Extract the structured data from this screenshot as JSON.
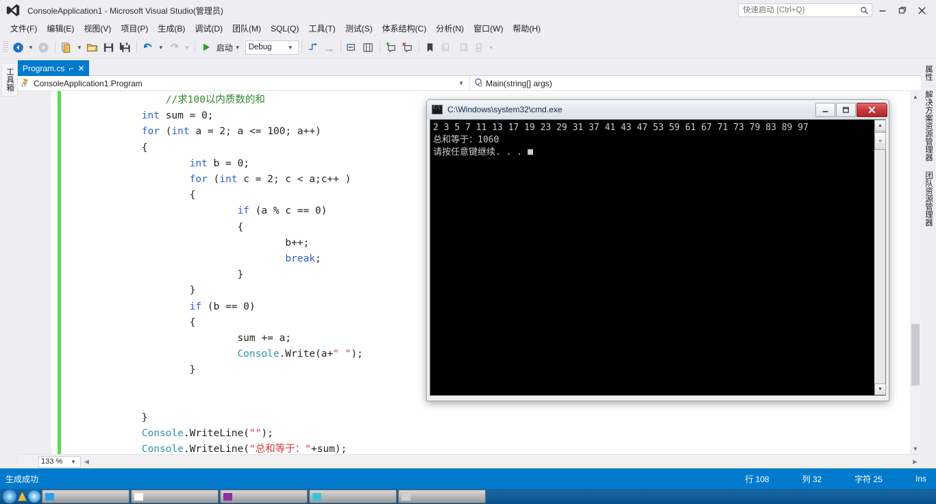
{
  "window": {
    "title": "ConsoleApplication1 - Microsoft Visual Studio(管理员)",
    "logo_icon": "visual-studio-logo",
    "minimize_icon": "—",
    "maximize_icon": "❐",
    "close_icon": "✕"
  },
  "quick_launch": {
    "placeholder": "快速启动 (Ctrl+Q)",
    "value": "",
    "icon": "search-icon"
  },
  "menubar": {
    "items": [
      {
        "label": "文件(F)"
      },
      {
        "label": "编辑(E)"
      },
      {
        "label": "视图(V)"
      },
      {
        "label": "项目(P)"
      },
      {
        "label": "生成(B)"
      },
      {
        "label": "调试(D)"
      },
      {
        "label": "团队(M)"
      },
      {
        "label": "SQL(Q)"
      },
      {
        "label": "工具(T)"
      },
      {
        "label": "测试(S)"
      },
      {
        "label": "体系结构(C)"
      },
      {
        "label": "分析(N)"
      },
      {
        "label": "窗口(W)"
      },
      {
        "label": "帮助(H)"
      }
    ]
  },
  "toolbar": {
    "navigate_back": "navigate-back-icon",
    "navigate_forward": "navigate-forward-icon",
    "new_project": "new-project-icon",
    "open_file": "open-file-icon",
    "save": "save-icon",
    "save_all": "save-all-icon",
    "undo": "undo-icon",
    "redo": "redo-icon",
    "start_label": "启动",
    "start_icon": "play-icon",
    "configuration": "Debug",
    "step_into": "step-into-icon",
    "step_over": "step-over-icon",
    "comment": "comment-icon",
    "uncomment": "uncomment-icon",
    "add_bookmark": "add-bookmark-icon",
    "remove_bookmark": "remove-bookmark-icon",
    "toggle_bookmark": "toggle-bookmark-icon",
    "prev_bookmark": "previous-bookmark-icon",
    "next_bookmark": "next-bookmark-icon",
    "clear_bookmarks": "clear-bookmarks-icon",
    "overflow": "toolbar-overflow-icon"
  },
  "left_dock": {
    "tabs": [
      {
        "label": "工具箱"
      }
    ]
  },
  "right_dock": {
    "tabs": [
      {
        "label": "属性"
      },
      {
        "label": "解决方案资源管理器"
      },
      {
        "label": "团队资源管理器"
      }
    ]
  },
  "editor": {
    "tab": {
      "label": "Program.cs",
      "pin_icon": "pin-icon",
      "close_icon": "close-icon"
    },
    "navbar": {
      "type_icon": "class-icon",
      "type": "ConsoleApplication1.Program",
      "member_icon": "method-icon",
      "member": "Main(string[] args)",
      "dropdown_icon": "chevron-down-icon"
    },
    "zoom_level": "133 %",
    "zoom_dropdown_icon": "chevron-down-icon",
    "code": [
      {
        "indent": 4,
        "tokens": [
          {
            "t": "//求100以内质数的和",
            "c": "cm"
          }
        ]
      },
      {
        "indent": 3,
        "tokens": [
          {
            "t": "int",
            "c": "kw"
          },
          {
            "t": " sum = 0;",
            "c": "pl"
          }
        ]
      },
      {
        "indent": 3,
        "tokens": [
          {
            "t": "for",
            "c": "kw"
          },
          {
            "t": " (",
            "c": "pl"
          },
          {
            "t": "int",
            "c": "kw"
          },
          {
            "t": " a = 2; a <= 100; a++)",
            "c": "pl"
          }
        ]
      },
      {
        "indent": 3,
        "tokens": [
          {
            "t": "{",
            "c": "pl"
          }
        ]
      },
      {
        "indent": 5,
        "tokens": [
          {
            "t": "int",
            "c": "kw"
          },
          {
            "t": " b = 0;",
            "c": "pl"
          }
        ]
      },
      {
        "indent": 5,
        "tokens": [
          {
            "t": "for",
            "c": "kw"
          },
          {
            "t": " (",
            "c": "pl"
          },
          {
            "t": "int",
            "c": "kw"
          },
          {
            "t": " c = 2; c < a;c++ )",
            "c": "pl"
          }
        ]
      },
      {
        "indent": 5,
        "tokens": [
          {
            "t": "{",
            "c": "pl"
          }
        ]
      },
      {
        "indent": 7,
        "tokens": [
          {
            "t": "if",
            "c": "kw"
          },
          {
            "t": " (a % c == 0)",
            "c": "pl"
          }
        ]
      },
      {
        "indent": 7,
        "tokens": [
          {
            "t": "{",
            "c": "pl"
          }
        ]
      },
      {
        "indent": 9,
        "tokens": [
          {
            "t": "b++;",
            "c": "pl"
          }
        ]
      },
      {
        "indent": 9,
        "tokens": [
          {
            "t": "break",
            "c": "kw"
          },
          {
            "t": ";",
            "c": "pl"
          }
        ]
      },
      {
        "indent": 7,
        "tokens": [
          {
            "t": "}",
            "c": "pl"
          }
        ]
      },
      {
        "indent": 5,
        "tokens": [
          {
            "t": "}",
            "c": "pl"
          }
        ]
      },
      {
        "indent": 5,
        "tokens": [
          {
            "t": "if",
            "c": "kw"
          },
          {
            "t": " (b == 0)",
            "c": "pl"
          }
        ]
      },
      {
        "indent": 5,
        "tokens": [
          {
            "t": "{",
            "c": "pl"
          }
        ]
      },
      {
        "indent": 7,
        "tokens": [
          {
            "t": "sum += a;",
            "c": "pl"
          }
        ]
      },
      {
        "indent": 7,
        "tokens": [
          {
            "t": "Console",
            "c": "ty"
          },
          {
            "t": ".Write(a+",
            "c": "pl"
          },
          {
            "t": "\" \"",
            "c": "st"
          },
          {
            "t": ");",
            "c": "pl"
          }
        ]
      },
      {
        "indent": 5,
        "tokens": [
          {
            "t": "}",
            "c": "pl"
          }
        ]
      },
      {
        "indent": 0,
        "tokens": [
          {
            "t": "",
            "c": "pl"
          }
        ]
      },
      {
        "indent": 0,
        "tokens": [
          {
            "t": "",
            "c": "pl"
          }
        ]
      },
      {
        "indent": 3,
        "tokens": [
          {
            "t": "}",
            "c": "pl"
          }
        ]
      },
      {
        "indent": 3,
        "tokens": [
          {
            "t": "Console",
            "c": "ty"
          },
          {
            "t": ".WriteLine(",
            "c": "pl"
          },
          {
            "t": "\"\"",
            "c": "st"
          },
          {
            "t": ");",
            "c": "pl"
          }
        ]
      },
      {
        "indent": 3,
        "tokens": [
          {
            "t": "Console",
            "c": "ty"
          },
          {
            "t": ".WriteLine(",
            "c": "pl"
          },
          {
            "t": "\"总和等于：\"",
            "c": "st"
          },
          {
            "t": "+sum);",
            "c": "pl"
          }
        ]
      }
    ]
  },
  "console_window": {
    "icon": "cmd-icon",
    "title": "C:\\Windows\\system32\\cmd.exe",
    "minimize_label": "─",
    "maximize_label": "❐",
    "close_label": "✕",
    "lines": [
      "2 3 5 7 11 13 17 19 23 29 31 37 41 43 47 53 59 61 67 71 73 79 83 89 97",
      "总和等于：1060",
      "请按任意键继续. . ."
    ],
    "scroll_up_icon": "scroll-up-icon",
    "scroll_down_icon": "scroll-down-icon"
  },
  "statusbar": {
    "build_status": "生成成功",
    "line_label": "行 108",
    "column_label": "列 32",
    "character_label": "字符 25",
    "insert_mode": "Ins",
    "accent_color": "#007acc"
  },
  "taskbar": {
    "items": [
      {
        "label": "",
        "color": "#2b9fe8"
      },
      {
        "label": "",
        "color": "#ffffff"
      },
      {
        "label": "",
        "color": "#8d2fa0"
      },
      {
        "label": "",
        "color": "#3ac3d8"
      },
      {
        "label": "",
        "color": "#cfcfcf"
      }
    ]
  }
}
